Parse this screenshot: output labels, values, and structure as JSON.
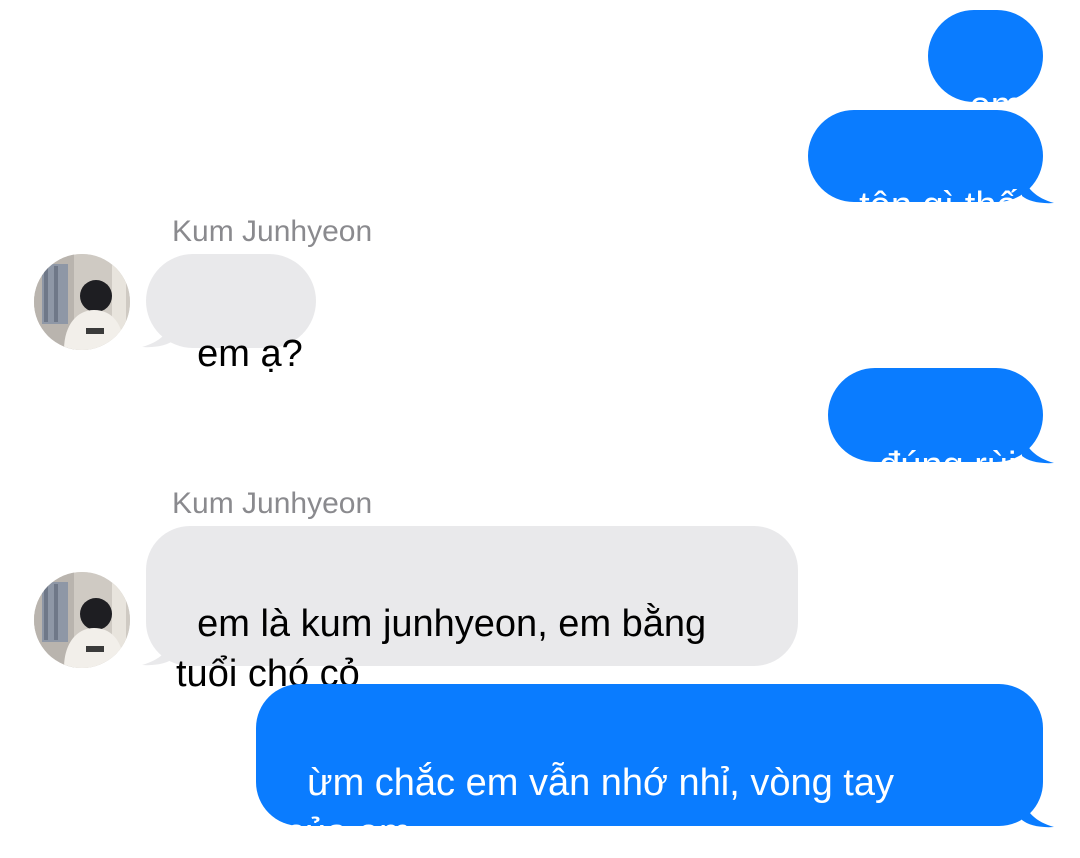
{
  "colors": {
    "sent_bubble": "#0a7cff",
    "received_bubble": "#e9e9eb",
    "sender_name": "#8a8a8e"
  },
  "messages": [
    {
      "direction": "sent",
      "text": "em"
    },
    {
      "direction": "sent",
      "text": "tên gì thế"
    },
    {
      "direction": "received",
      "sender": "Kum Junhyeon",
      "text": "em ạ?"
    },
    {
      "direction": "sent",
      "text": "đúng rùi"
    },
    {
      "direction": "received",
      "sender": "Kum Junhyeon",
      "text": "em là kum junhyeon, em bằng\ntuổi chó cỏ"
    },
    {
      "direction": "sent",
      "text": "ừm chắc em vẫn nhớ nhỉ, vòng tay\ncủa em"
    }
  ],
  "avatar": {
    "icon": "profile-photo-avatar"
  }
}
